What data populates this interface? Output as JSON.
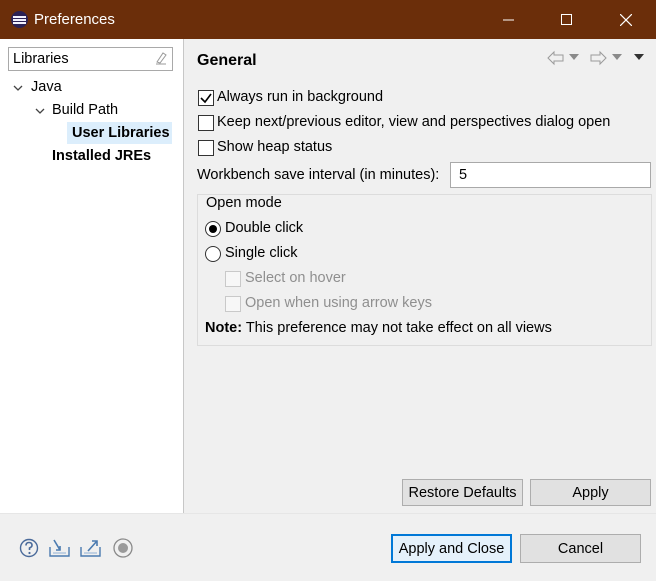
{
  "window": {
    "title": "Preferences"
  },
  "filter": {
    "value": "Libraries"
  },
  "tree": {
    "java": "Java",
    "build_path": "Build Path",
    "user_libraries": "User Libraries",
    "installed_jres": "Installed JREs"
  },
  "page": {
    "title": "General",
    "always_run_bg": {
      "label": "Always run in background",
      "checked": true
    },
    "keep_next_prev": {
      "label": "Keep next/previous editor, view and perspectives dialog open",
      "checked": false
    },
    "show_heap": {
      "label": "Show heap status",
      "checked": false
    },
    "interval": {
      "label": "Workbench save interval (in minutes):",
      "value": "5"
    },
    "open_mode": {
      "title": "Open mode",
      "double_click": "Double click",
      "single_click": "Single click",
      "select_on_hover": "Select on hover",
      "open_arrow_keys": "Open when using arrow keys",
      "selected": "Double click"
    },
    "note_bold": "Note:",
    "note_text": " This preference may not take effect on all views",
    "restore_defaults": "Restore Defaults",
    "apply": "Apply"
  },
  "footer": {
    "apply_close": "Apply and Close",
    "cancel": "Cancel"
  },
  "icons": {
    "help": "help-icon",
    "import": "import-icon",
    "export": "export-icon",
    "record": "record-icon"
  },
  "colors": {
    "titlebar": "#6b2e0a",
    "selection": "#dceefc",
    "default_button_border": "#0078d7"
  }
}
